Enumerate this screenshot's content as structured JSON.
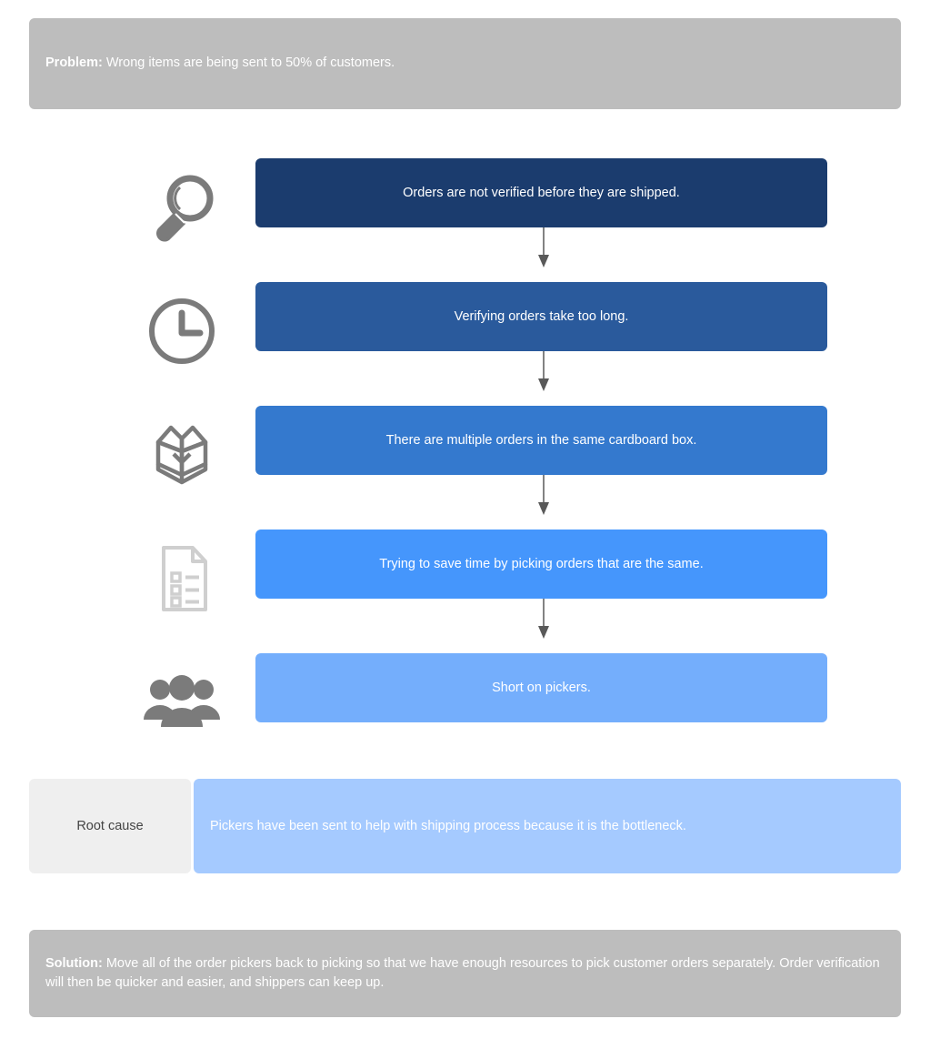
{
  "problem": {
    "label": "Problem:",
    "text": " Wrong items are being sent to 50% of customers."
  },
  "solution": {
    "label": "Solution:",
    "text": " Move all of the order pickers back to picking so that we have enough resources to pick customer orders separately. Order verification will then be quicker and easier, and shippers can keep up."
  },
  "whys": [
    {
      "icon": "magnifier-icon",
      "text": "Orders are not verified before they are shipped.",
      "color": "#1b3c6e"
    },
    {
      "icon": "clock-icon",
      "text": "Verifying orders take too long.",
      "color": "#2a5a9c"
    },
    {
      "icon": "open-box-icon",
      "text": "There are multiple orders in the same cardboard box.",
      "color": "#3479ce"
    },
    {
      "icon": "checklist-document-icon",
      "text": "Trying to save time by picking orders that are the same.",
      "color": "#4596fc"
    },
    {
      "icon": "people-group-icon",
      "text": "Short on pickers.",
      "color": "#74aefc"
    }
  ],
  "root_cause": {
    "label": "Root cause",
    "text": "Pickers have been sent to help with shipping process because it is the bottleneck."
  },
  "colors": {
    "banner_gray": "#bdbdbd",
    "root_cause_label_gray": "#efefef",
    "root_cause_blue": "#a5caff",
    "icon_gray": "#7b7b7b",
    "connector_gray": "#595959"
  }
}
